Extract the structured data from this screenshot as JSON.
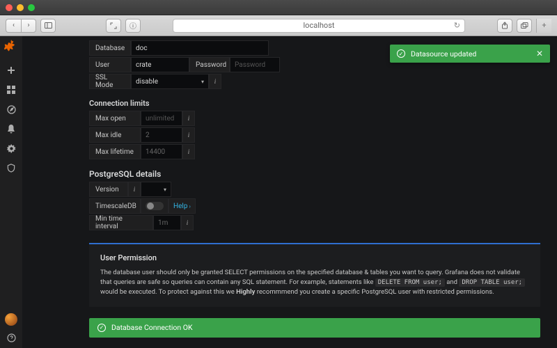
{
  "browser": {
    "url": "localhost"
  },
  "toast": {
    "message": "Datasource updated"
  },
  "form": {
    "database_label": "Database",
    "database_value": "doc",
    "user_label": "User",
    "user_value": "crate",
    "password_label": "Password",
    "password_placeholder": "Password",
    "sslmode_label": "SSL Mode",
    "sslmode_value": "disable"
  },
  "limits": {
    "heading": "Connection limits",
    "max_open_label": "Max open",
    "max_open_placeholder": "unlimited",
    "max_idle_label": "Max idle",
    "max_idle_value": "2",
    "max_lifetime_label": "Max lifetime",
    "max_lifetime_value": "14400"
  },
  "pg": {
    "heading": "PostgreSQL details",
    "version_label": "Version",
    "timescaledb_label": "TimescaleDB",
    "help_label": "Help",
    "min_interval_label": "Min time interval",
    "min_interval_value": "1m"
  },
  "perm": {
    "heading": "User Permission",
    "p1a": "The database user should only be granted SELECT permissions on the specified database & tables you want to query. Grafana does not validate that queries are safe so queries can contain any SQL statement. For example, statements like ",
    "code1": "DELETE FROM user;",
    "and": " and ",
    "code2": "DROP TABLE user;",
    "p1b": " would be executed. To protect against this we ",
    "highly": "Highly",
    "p1c": " recommmend you create a specific PostgreSQL user with restricted permissions."
  },
  "status": {
    "ok": "Database Connection OK"
  }
}
